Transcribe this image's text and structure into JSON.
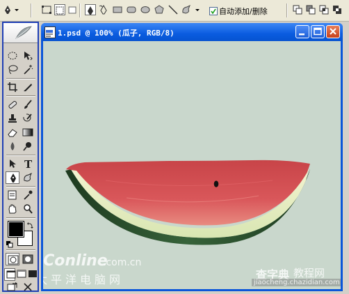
{
  "options_bar": {
    "auto_add_delete_label": "自动添加/删除",
    "auto_add_delete_checked": true
  },
  "toolbox": {
    "tools": [
      "marquee-tool",
      "move-tool",
      "lasso-tool",
      "magic-wand-tool",
      "crop-tool",
      "slice-tool",
      "healing-brush-tool",
      "brush-tool",
      "clone-stamp-tool",
      "history-brush-tool",
      "eraser-tool",
      "gradient-tool",
      "blur-tool",
      "dodge-tool",
      "path-selection-tool",
      "type-tool",
      "pen-tool",
      "custom-shape-tool",
      "notes-tool",
      "eyedropper-tool",
      "hand-tool",
      "zoom-tool"
    ],
    "selected_tool": "pen-tool",
    "foreground_color": "#000000",
    "background_color": "#ffffff"
  },
  "document": {
    "title": "1.psd @ 100% (瓜子, RGB/8)",
    "canvas_color": "#c9d7cc"
  },
  "watermarks": {
    "left_brand": "PConline",
    "left_domain": ".com.cn",
    "left_sub": "太平洋电脑网",
    "right_brand": "查字典",
    "right_sub": "教程网",
    "right_url": "jiaocheng.chazidian.com"
  }
}
